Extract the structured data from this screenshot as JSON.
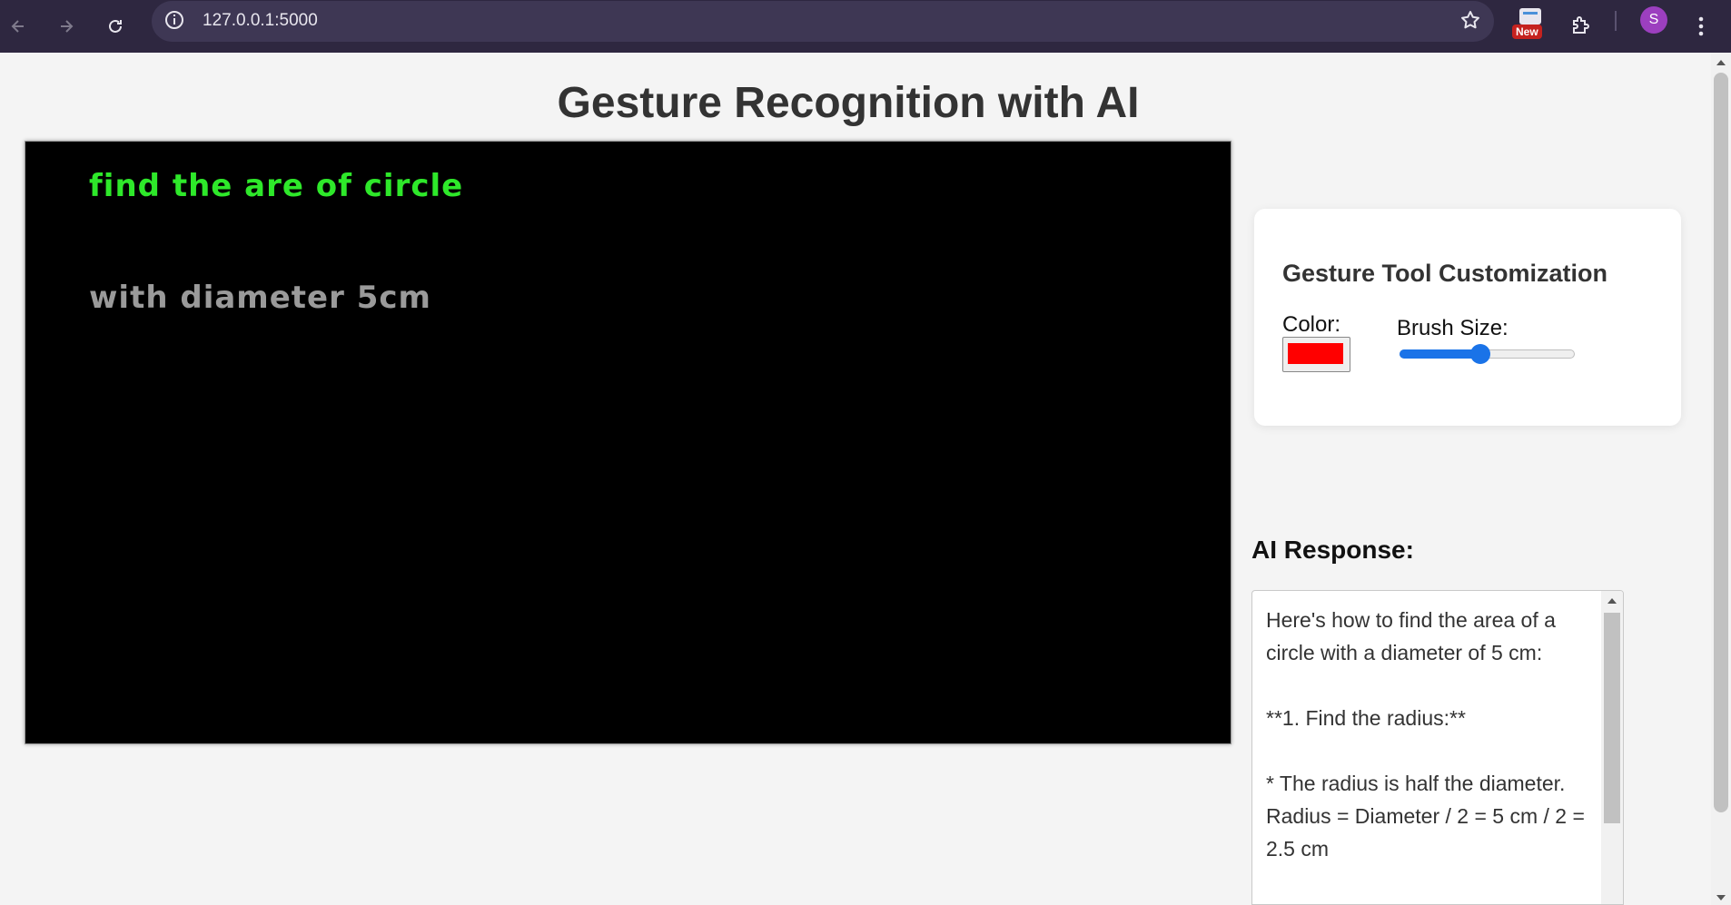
{
  "browser": {
    "url": "127.0.0.1:5000",
    "extension_badge": "New",
    "profile_initial": "S",
    "icons": [
      "back-icon",
      "forward-icon",
      "reload-icon",
      "site-info-icon",
      "bookmark-star-icon",
      "extension-new-icon",
      "extensions-puzzle-icon",
      "menu-kebab-icon"
    ]
  },
  "page": {
    "title": "Gesture Recognition with AI"
  },
  "canvas": {
    "lines": [
      "find the are of circle",
      "with diameter 5cm"
    ],
    "line_colors": [
      "#2ee82a",
      "#9a9a9a"
    ]
  },
  "customization": {
    "heading": "Gesture Tool Customization",
    "color_label": "Color:",
    "color_value": "#ff0000",
    "brush_label": "Brush Size:",
    "brush_fraction": 0.46
  },
  "ai": {
    "heading": "AI Response:",
    "response": "Here's how to find the area of a circle with a diameter of 5 cm:\n\n**1. Find the radius:**\n\n* The radius is half the diameter. Radius = Diameter / 2 = 5 cm / 2 = 2.5 cm"
  },
  "colors": {
    "chrome_bg": "#2e2740",
    "accent": "#1a73e8"
  }
}
